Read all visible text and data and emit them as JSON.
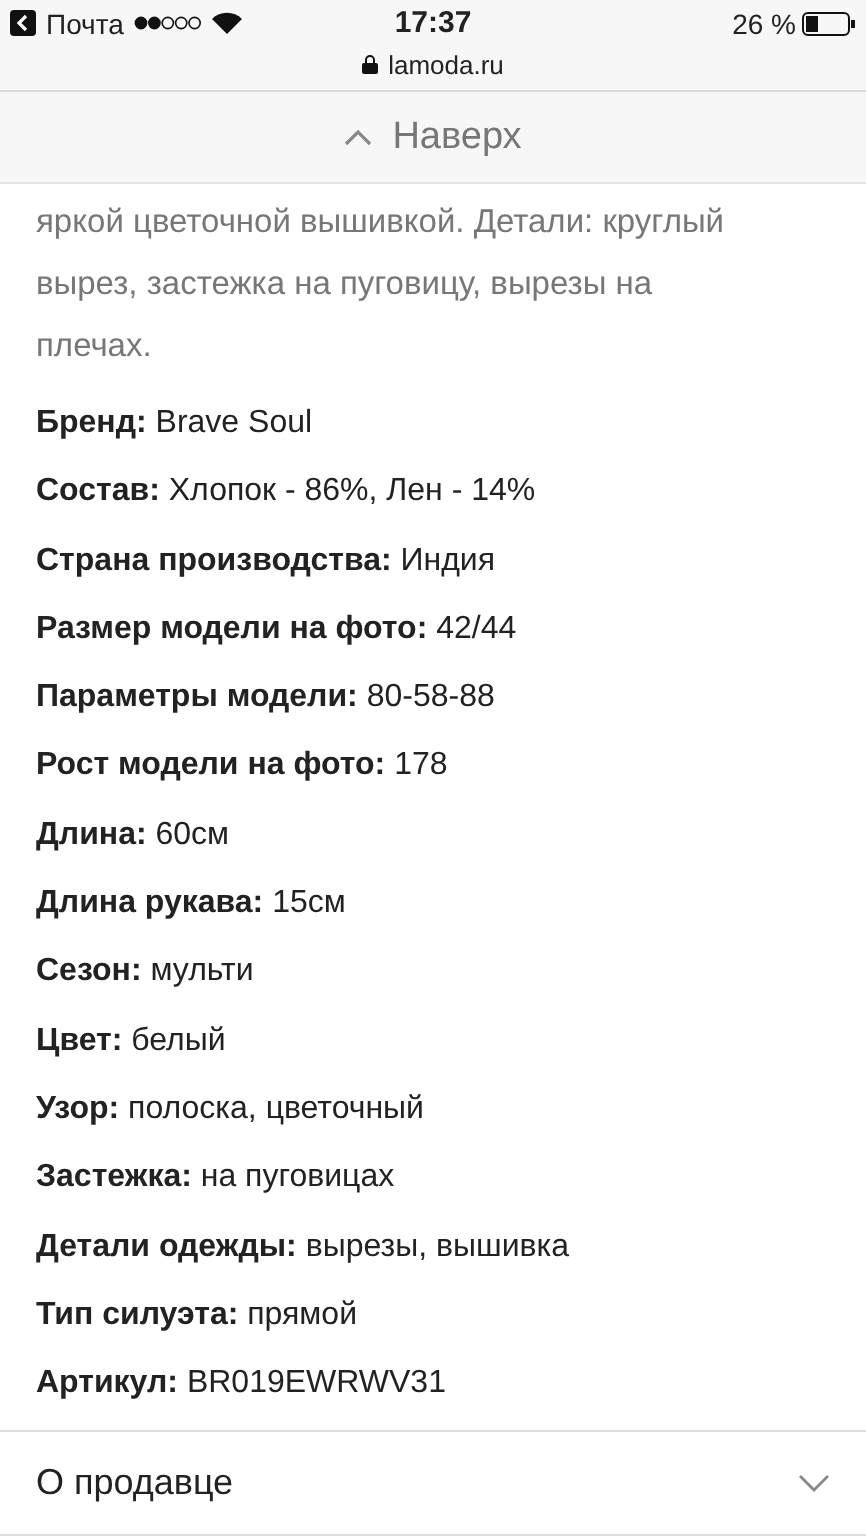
{
  "status_bar": {
    "back_app": "Почта",
    "time": "17:37",
    "battery": "26 %",
    "url": "lamoda.ru"
  },
  "top_bar": {
    "label": "Наверх"
  },
  "description": "яркой цветочной вышивкой. Детали: круглый вырез, застежка на пуговицу, вырезы на плечах.",
  "specs": [
    {
      "label": "Бренд:",
      "value": "Brave Soul"
    },
    {
      "label": "Состав:",
      "value": "Хлопок - 86%, Лен - 14%"
    },
    {
      "label": "Страна производства:",
      "value": "Индия"
    },
    {
      "label": "Размер модели на фото:",
      "value": "42/44"
    },
    {
      "label": "Параметры модели:",
      "value": "80-58-88"
    },
    {
      "label": "Рост модели на фото:",
      "value": "178"
    },
    {
      "label": "Длина:",
      "value": "60см"
    },
    {
      "label": "Длина рукава:",
      "value": "15см"
    },
    {
      "label": "Сезон:",
      "value": "мульти"
    },
    {
      "label": "Цвет:",
      "value": "белый"
    },
    {
      "label": "Узор:",
      "value": "полоска, цветочный"
    },
    {
      "label": "Застежка:",
      "value": "на пуговицах"
    },
    {
      "label": "Детали одежды:",
      "value": "вырезы, вышивка"
    },
    {
      "label": "Тип силуэта:",
      "value": "прямой"
    },
    {
      "label": "Артикул:",
      "value": "BR019EWRWV31"
    }
  ],
  "sections": [
    {
      "title": "О продавце",
      "expanded": false
    }
  ]
}
